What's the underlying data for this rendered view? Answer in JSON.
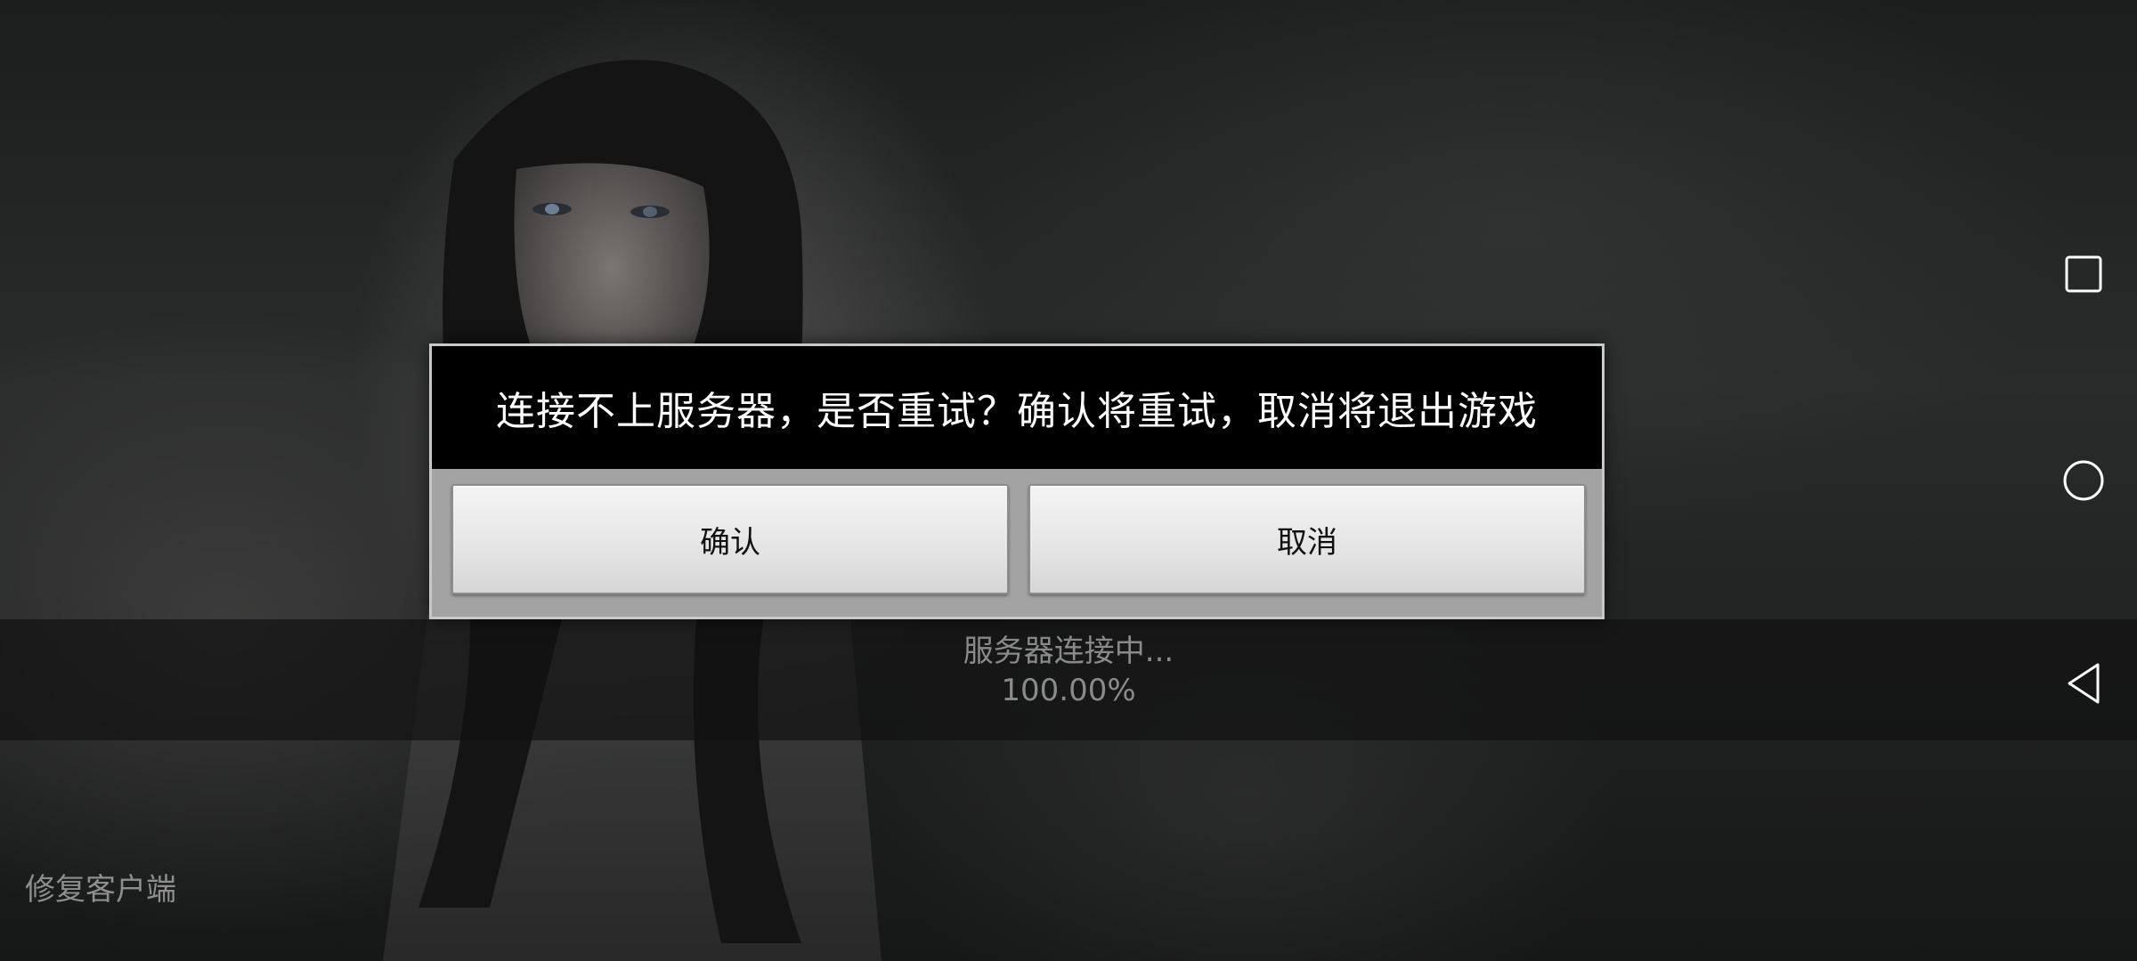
{
  "dialog": {
    "message": "连接不上服务器，是否重试？确认将重试，取消将退出游戏",
    "confirm_label": "确认",
    "cancel_label": "取消"
  },
  "status": {
    "message": "服务器连接中...",
    "progress_text": "100.00%",
    "progress_percent": 100
  },
  "repair_link": "修复客户端",
  "navbar": {
    "icons": [
      "recents-icon",
      "home-icon",
      "back-icon"
    ]
  },
  "colors": {
    "dialog_header_bg": "#000000",
    "dialog_frame": "#a3a3a3",
    "status_text": "#8a8a8a",
    "nav_icon": "#ffffff"
  }
}
